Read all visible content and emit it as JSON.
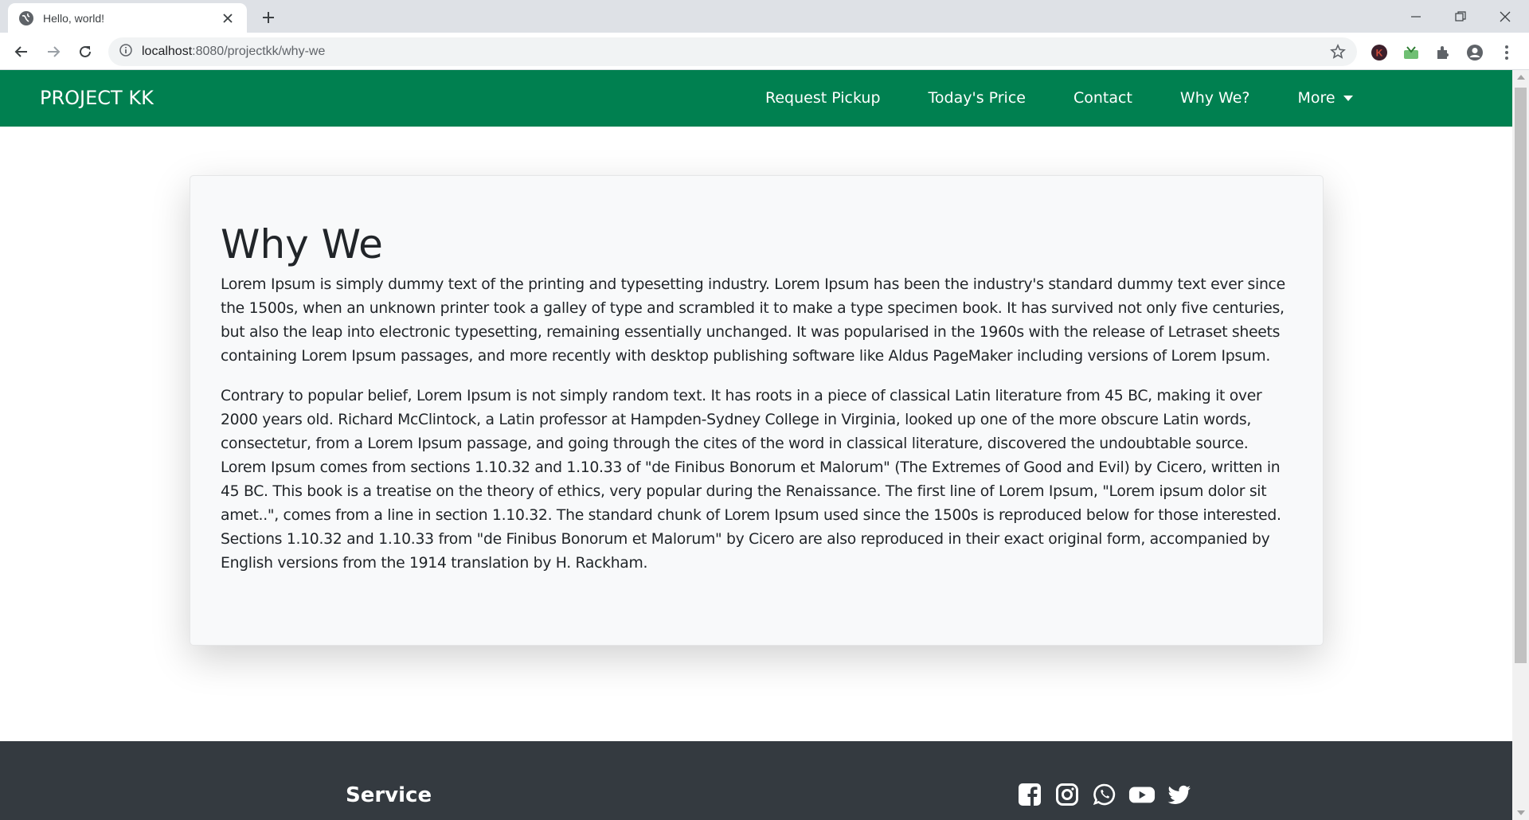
{
  "browser": {
    "tab_title": "Hello, world!",
    "url_host": "localhost",
    "url_path": ":8080/projectkk/why-we"
  },
  "navbar": {
    "brand": "PROJECT KK",
    "links": [
      "Request Pickup",
      "Today's Price",
      "Contact",
      "Why We?",
      "More"
    ]
  },
  "card": {
    "heading": "Why We",
    "paragraphs": [
      "Lorem Ipsum is simply dummy text of the printing and typesetting industry. Lorem Ipsum has been the industry's standard dummy text ever since the 1500s, when an unknown printer took a galley of type and scrambled it to make a type specimen book. It has survived not only five centuries, but also the leap into electronic typesetting, remaining essentially unchanged. It was popularised in the 1960s with the release of Letraset sheets containing Lorem Ipsum passages, and more recently with desktop publishing software like Aldus PageMaker including versions of Lorem Ipsum.",
      "Contrary to popular belief, Lorem Ipsum is not simply random text. It has roots in a piece of classical Latin literature from 45 BC, making it over 2000 years old. Richard McClintock, a Latin professor at Hampden-Sydney College in Virginia, looked up one of the more obscure Latin words, consectetur, from a Lorem Ipsum passage, and going through the cites of the word in classical literature, discovered the undoubtable source. Lorem Ipsum comes from sections 1.10.32 and 1.10.33 of \"de Finibus Bonorum et Malorum\" (The Extremes of Good and Evil) by Cicero, written in 45 BC. This book is a treatise on the theory of ethics, very popular during the Renaissance. The first line of Lorem Ipsum, \"Lorem ipsum dolor sit amet..\", comes from a line in section 1.10.32. The standard chunk of Lorem Ipsum used since the 1500s is reproduced below for those interested. Sections 1.10.32 and 1.10.33 from \"de Finibus Bonorum et Malorum\" by Cicero are also reproduced in their exact original form, accompanied by English versions from the 1914 translation by H. Rackham."
    ]
  },
  "footer": {
    "service_heading": "Service",
    "social_icons": [
      "facebook-icon",
      "instagram-icon",
      "whatsapp-icon",
      "youtube-icon",
      "twitter-icon"
    ]
  },
  "colors": {
    "navbar": "#008050",
    "footer": "#343a40",
    "card_bg": "#f8f9fa"
  }
}
